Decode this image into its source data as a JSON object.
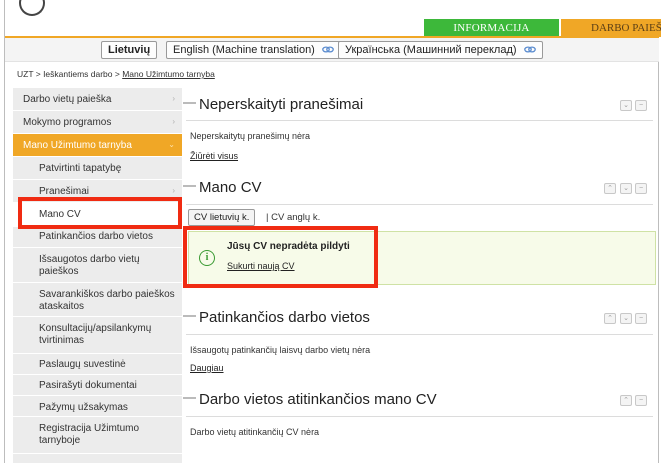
{
  "header": {
    "tab_informacija": "INFORMACIJA",
    "tab_darbo": "DARBO PAIEŠ"
  },
  "languages": [
    {
      "label": "Lietuvių",
      "active": true
    },
    {
      "label": "English (Machine translation)",
      "icon": "external-link-icon"
    },
    {
      "label": "Українська (Машинний переклад)",
      "icon": "external-link-icon"
    }
  ],
  "breadcrumb": {
    "part1": "UZT",
    "sep": " > ",
    "part2": "Ieškantiems darbo",
    "part3": "Mano Užimtumo tarnyba"
  },
  "sidebar": {
    "items": [
      {
        "label": "Darbo vietų paieška",
        "arrow": "›"
      },
      {
        "label": "Mokymo programos",
        "arrow": "›"
      },
      {
        "label": "Mano Užimtumo tarnyba",
        "arrow": "⌄"
      },
      {
        "label": "Patvirtinti tapatybę"
      },
      {
        "label": "Pranešimai",
        "arrow": "›"
      },
      {
        "label": "Mano CV"
      },
      {
        "label": "Patinkančios darbo vietos"
      },
      {
        "label": "Išsaugotos darbo vietų paieškos"
      },
      {
        "label": "Savarankiškos darbo paieškos ataskaitos"
      },
      {
        "label": "Konsultacijų/apsilankymų tvirtinimas"
      },
      {
        "label": "Paslaugų suvestinė"
      },
      {
        "label": "Pasirašyti dokumentai"
      },
      {
        "label": "Pažymų užsakymas"
      },
      {
        "label": "Registracija Užimtumo tarnyboje"
      }
    ]
  },
  "panels": {
    "pranesimai": {
      "title": "Neperskaityti pranešimai",
      "body": "Neperskaitytų pranešimų nėra",
      "link": "Žiūrėti visus"
    },
    "cv": {
      "title": "Mano CV",
      "tab_lt": "CV lietuvių k.",
      "tab_en": "| CV anglų k.",
      "notice_title": "Jūsų CV nepradėta pildyti",
      "notice_link": "Sukurti naują CV"
    },
    "patinkancios": {
      "title": "Patinkančios darbo vietos",
      "body": "Išsaugotų patinkančių laisvų darbo vietų nėra",
      "link": "Daugiau"
    },
    "atitinkancios": {
      "title": "Darbo vietos atitinkančios mano CV",
      "body": "Darbo vietų atitinkančių CV nėra"
    }
  },
  "panel_buttons": {
    "collapse": "⌄",
    "close": "−",
    "expand": "⌃"
  },
  "colors": {
    "green_tab": "#3db83a",
    "orange_accent": "#f0a726",
    "highlight_red": "#f02b12"
  }
}
